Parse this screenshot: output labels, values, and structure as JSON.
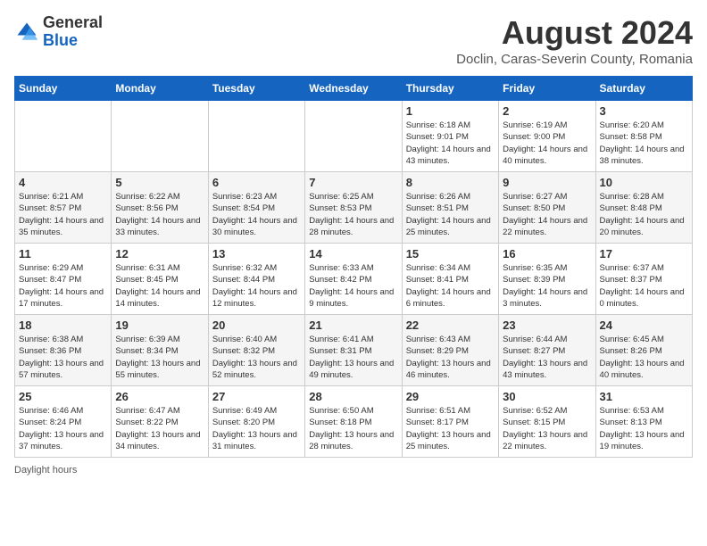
{
  "header": {
    "logo_line1": "General",
    "logo_line2": "Blue",
    "main_title": "August 2024",
    "subtitle": "Doclin, Caras-Severin County, Romania"
  },
  "weekdays": [
    "Sunday",
    "Monday",
    "Tuesday",
    "Wednesday",
    "Thursday",
    "Friday",
    "Saturday"
  ],
  "weeks": [
    [
      {
        "day": "",
        "info": ""
      },
      {
        "day": "",
        "info": ""
      },
      {
        "day": "",
        "info": ""
      },
      {
        "day": "",
        "info": ""
      },
      {
        "day": "1",
        "info": "Sunrise: 6:18 AM\nSunset: 9:01 PM\nDaylight: 14 hours and 43 minutes."
      },
      {
        "day": "2",
        "info": "Sunrise: 6:19 AM\nSunset: 9:00 PM\nDaylight: 14 hours and 40 minutes."
      },
      {
        "day": "3",
        "info": "Sunrise: 6:20 AM\nSunset: 8:58 PM\nDaylight: 14 hours and 38 minutes."
      }
    ],
    [
      {
        "day": "4",
        "info": "Sunrise: 6:21 AM\nSunset: 8:57 PM\nDaylight: 14 hours and 35 minutes."
      },
      {
        "day": "5",
        "info": "Sunrise: 6:22 AM\nSunset: 8:56 PM\nDaylight: 14 hours and 33 minutes."
      },
      {
        "day": "6",
        "info": "Sunrise: 6:23 AM\nSunset: 8:54 PM\nDaylight: 14 hours and 30 minutes."
      },
      {
        "day": "7",
        "info": "Sunrise: 6:25 AM\nSunset: 8:53 PM\nDaylight: 14 hours and 28 minutes."
      },
      {
        "day": "8",
        "info": "Sunrise: 6:26 AM\nSunset: 8:51 PM\nDaylight: 14 hours and 25 minutes."
      },
      {
        "day": "9",
        "info": "Sunrise: 6:27 AM\nSunset: 8:50 PM\nDaylight: 14 hours and 22 minutes."
      },
      {
        "day": "10",
        "info": "Sunrise: 6:28 AM\nSunset: 8:48 PM\nDaylight: 14 hours and 20 minutes."
      }
    ],
    [
      {
        "day": "11",
        "info": "Sunrise: 6:29 AM\nSunset: 8:47 PM\nDaylight: 14 hours and 17 minutes."
      },
      {
        "day": "12",
        "info": "Sunrise: 6:31 AM\nSunset: 8:45 PM\nDaylight: 14 hours and 14 minutes."
      },
      {
        "day": "13",
        "info": "Sunrise: 6:32 AM\nSunset: 8:44 PM\nDaylight: 14 hours and 12 minutes."
      },
      {
        "day": "14",
        "info": "Sunrise: 6:33 AM\nSunset: 8:42 PM\nDaylight: 14 hours and 9 minutes."
      },
      {
        "day": "15",
        "info": "Sunrise: 6:34 AM\nSunset: 8:41 PM\nDaylight: 14 hours and 6 minutes."
      },
      {
        "day": "16",
        "info": "Sunrise: 6:35 AM\nSunset: 8:39 PM\nDaylight: 14 hours and 3 minutes."
      },
      {
        "day": "17",
        "info": "Sunrise: 6:37 AM\nSunset: 8:37 PM\nDaylight: 14 hours and 0 minutes."
      }
    ],
    [
      {
        "day": "18",
        "info": "Sunrise: 6:38 AM\nSunset: 8:36 PM\nDaylight: 13 hours and 57 minutes."
      },
      {
        "day": "19",
        "info": "Sunrise: 6:39 AM\nSunset: 8:34 PM\nDaylight: 13 hours and 55 minutes."
      },
      {
        "day": "20",
        "info": "Sunrise: 6:40 AM\nSunset: 8:32 PM\nDaylight: 13 hours and 52 minutes."
      },
      {
        "day": "21",
        "info": "Sunrise: 6:41 AM\nSunset: 8:31 PM\nDaylight: 13 hours and 49 minutes."
      },
      {
        "day": "22",
        "info": "Sunrise: 6:43 AM\nSunset: 8:29 PM\nDaylight: 13 hours and 46 minutes."
      },
      {
        "day": "23",
        "info": "Sunrise: 6:44 AM\nSunset: 8:27 PM\nDaylight: 13 hours and 43 minutes."
      },
      {
        "day": "24",
        "info": "Sunrise: 6:45 AM\nSunset: 8:26 PM\nDaylight: 13 hours and 40 minutes."
      }
    ],
    [
      {
        "day": "25",
        "info": "Sunrise: 6:46 AM\nSunset: 8:24 PM\nDaylight: 13 hours and 37 minutes."
      },
      {
        "day": "26",
        "info": "Sunrise: 6:47 AM\nSunset: 8:22 PM\nDaylight: 13 hours and 34 minutes."
      },
      {
        "day": "27",
        "info": "Sunrise: 6:49 AM\nSunset: 8:20 PM\nDaylight: 13 hours and 31 minutes."
      },
      {
        "day": "28",
        "info": "Sunrise: 6:50 AM\nSunset: 8:18 PM\nDaylight: 13 hours and 28 minutes."
      },
      {
        "day": "29",
        "info": "Sunrise: 6:51 AM\nSunset: 8:17 PM\nDaylight: 13 hours and 25 minutes."
      },
      {
        "day": "30",
        "info": "Sunrise: 6:52 AM\nSunset: 8:15 PM\nDaylight: 13 hours and 22 minutes."
      },
      {
        "day": "31",
        "info": "Sunrise: 6:53 AM\nSunset: 8:13 PM\nDaylight: 13 hours and 19 minutes."
      }
    ]
  ],
  "footer": {
    "note": "Daylight hours"
  }
}
